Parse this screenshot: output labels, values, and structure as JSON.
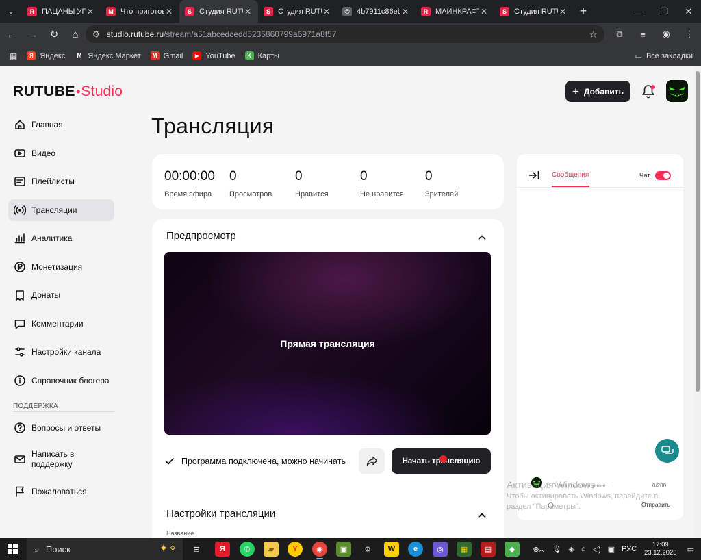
{
  "browser": {
    "tabs": [
      {
        "title": "ПАЦАНЫ УГН",
        "fav": "R",
        "fav_color": "#e8264a"
      },
      {
        "title": "Что приготов",
        "fav": "M",
        "fav_color": "#d62a3c"
      },
      {
        "title": "Студия RUTU",
        "fav": "S",
        "fav_color": "#e8264a",
        "active": true
      },
      {
        "title": "Студия RUTU",
        "fav": "S",
        "fav_color": "#e8264a"
      },
      {
        "title": "4b7911c86eb",
        "fav": "◎",
        "fav_color": "#5f6368"
      },
      {
        "title": "МАЙНКРАФТ",
        "fav": "R",
        "fav_color": "#e8264a"
      },
      {
        "title": "Студия RUTU",
        "fav": "S",
        "fav_color": "#e8264a"
      }
    ],
    "url_host": "studio.rutube.ru",
    "url_path": "/stream/a51abcedcedd5235860799a6971a8f57",
    "bookmarks": [
      {
        "label": "Яндекс",
        "icon": "Я",
        "color": "#fc3f1d"
      },
      {
        "label": "Яндекс Маркет",
        "icon": "M",
        "color": "#333333"
      },
      {
        "label": "Gmail",
        "icon": "M",
        "color": "#d93025"
      },
      {
        "label": "YouTube",
        "icon": "▶",
        "color": "#ff0000"
      },
      {
        "label": "Карты",
        "icon": "K",
        "color": "#4caf50"
      }
    ],
    "all_bookmarks": "Все закладки"
  },
  "logo": {
    "brand": "RUTUBE",
    "product": "Studio"
  },
  "sidebar": {
    "items": [
      {
        "label": "Главная",
        "icon": "home-icon"
      },
      {
        "label": "Видео",
        "icon": "video-icon"
      },
      {
        "label": "Плейлисты",
        "icon": "playlist-icon"
      },
      {
        "label": "Трансляции",
        "icon": "broadcast-icon",
        "active": true
      },
      {
        "label": "Аналитика",
        "icon": "analytics-icon"
      },
      {
        "label": "Монетизация",
        "icon": "ruble-icon"
      },
      {
        "label": "Донаты",
        "icon": "donate-icon"
      },
      {
        "label": "Комментарии",
        "icon": "comments-icon"
      },
      {
        "label": "Настройки канала",
        "icon": "settings-icon"
      },
      {
        "label": "Справочник блогера",
        "icon": "info-icon"
      }
    ],
    "support_title": "ПОДДЕРЖКА",
    "support_items": [
      {
        "label": "Вопросы и ответы",
        "icon": "help-icon"
      },
      {
        "label": "Написать в поддержку",
        "icon": "mail-icon"
      },
      {
        "label": "Пожаловаться",
        "icon": "flag-icon"
      }
    ]
  },
  "header": {
    "add_label": "Добавить"
  },
  "page_title": "Трансляция",
  "stats": [
    {
      "value": "00:00:00",
      "label": "Время эфира"
    },
    {
      "value": "0",
      "label": "Просмотров"
    },
    {
      "value": "0",
      "label": "Нравится"
    },
    {
      "value": "0",
      "label": "Не нравится"
    },
    {
      "value": "0",
      "label": "Зрителей"
    }
  ],
  "preview": {
    "title": "Предпросмотр",
    "video_label": "Прямая трансляция",
    "status": "Программа подключена, можно начинать",
    "start_label": "Начать трансляцию"
  },
  "settings": {
    "title": "Настройки трансляции",
    "field_label": "Название"
  },
  "chat": {
    "tab_messages": "Сообщения",
    "chat_label": "Чат",
    "toggle_on": true,
    "input_placeholder": "Оставить сообщение...",
    "counter": "0/200",
    "send_label": "Отправить"
  },
  "windows_activation": {
    "title": "Активация Windows",
    "line1": "Чтобы активировать Windows, перейдите в",
    "line2": "раздел \"Параметры\"."
  },
  "taskbar": {
    "search_label": "Поиск",
    "lang": "РУС",
    "time": "17:09",
    "date": "23.12.2025"
  },
  "colors": {
    "accent": "#ff2c55",
    "dark_button": "#222226",
    "page_bg": "#f4f4f5"
  }
}
